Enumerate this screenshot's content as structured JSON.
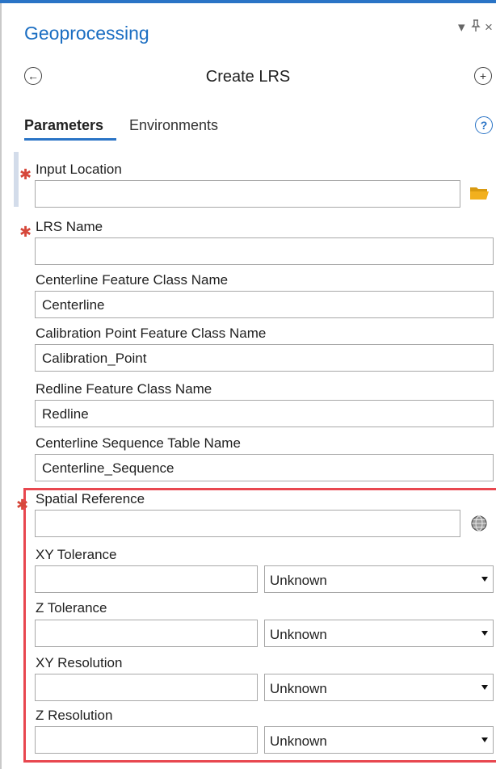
{
  "pane": {
    "title": "Geoprocessing",
    "pin_glyph": "↕",
    "close_glyph": "×",
    "menu_glyph": "▾"
  },
  "tool": {
    "title": "Create LRS",
    "back_glyph": "←",
    "add_glyph": "+"
  },
  "tabs": [
    {
      "label": "Parameters",
      "active": true
    },
    {
      "label": "Environments",
      "active": false
    }
  ],
  "help_glyph": "?",
  "required_marker": "✱",
  "params": {
    "input_location": {
      "label": "Input Location",
      "value": ""
    },
    "lrs_name": {
      "label": "LRS Name",
      "value": ""
    },
    "centerline_fc": {
      "label": "Centerline Feature Class Name",
      "value": "Centerline"
    },
    "calibration_fc": {
      "label": "Calibration Point Feature Class Name",
      "value": "Calibration_Point"
    },
    "redline_fc": {
      "label": "Redline Feature Class Name",
      "value": "Redline"
    },
    "sequence_table": {
      "label": "Centerline Sequence Table Name",
      "value": "Centerline_Sequence"
    },
    "spatial_reference": {
      "label": "Spatial Reference",
      "value": ""
    },
    "xy_tolerance": {
      "label": "XY Tolerance",
      "value": "",
      "unit": "Unknown"
    },
    "z_tolerance": {
      "label": "Z Tolerance",
      "value": "",
      "unit": "Unknown"
    },
    "xy_resolution": {
      "label": "XY Resolution",
      "value": "",
      "unit": "Unknown"
    },
    "z_resolution": {
      "label": "Z Resolution",
      "value": "",
      "unit": "Unknown"
    }
  },
  "colors": {
    "accent": "#2a74c6",
    "title": "#1b6ec2",
    "required": "#d6483b",
    "highlight": "#e8474f",
    "folder": "#f2b01e"
  }
}
